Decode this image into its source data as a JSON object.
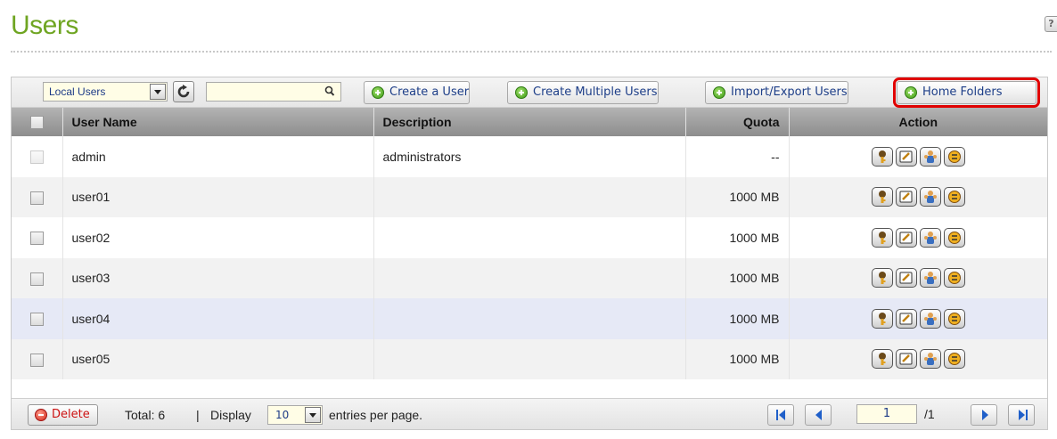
{
  "page": {
    "title": "Users",
    "help_label": "?"
  },
  "toolbar": {
    "source_select": "Local Users",
    "search_placeholder": "",
    "buttons": {
      "create_user": "Create a User",
      "create_multiple": "Create Multiple Users",
      "import_export": "Import/Export Users",
      "home_folders": "Home Folders"
    },
    "highlighted_button": "Home Folders",
    "highlight_color": "#e00000"
  },
  "table": {
    "headers": {
      "user_name": "User Name",
      "description": "Description",
      "quota": "Quota",
      "action": "Action"
    },
    "rows": [
      {
        "user_name": "admin",
        "description": "administrators",
        "quota": "--"
      },
      {
        "user_name": "user01",
        "description": "",
        "quota": "1000 MB"
      },
      {
        "user_name": "user02",
        "description": "",
        "quota": "1000 MB"
      },
      {
        "user_name": "user03",
        "description": "",
        "quota": "1000 MB"
      },
      {
        "user_name": "user04",
        "description": "",
        "quota": "1000 MB"
      },
      {
        "user_name": "user05",
        "description": "",
        "quota": "1000 MB"
      }
    ],
    "row_actions": [
      "password-key-icon",
      "edit-icon",
      "group-icon",
      "folder-quota-icon"
    ]
  },
  "footer": {
    "delete_label": "Delete",
    "total_label": "Total: 6",
    "separator": "|",
    "display_label": "Display",
    "per_page_value": "10",
    "entries_label": "entries per page.",
    "current_page": "1",
    "total_pages": "/1"
  },
  "colors": {
    "title_green": "#6fa522",
    "link_blue": "#1d3e88",
    "header_gray": "#9e9e9e",
    "hover_row": "#e6e9f6"
  }
}
